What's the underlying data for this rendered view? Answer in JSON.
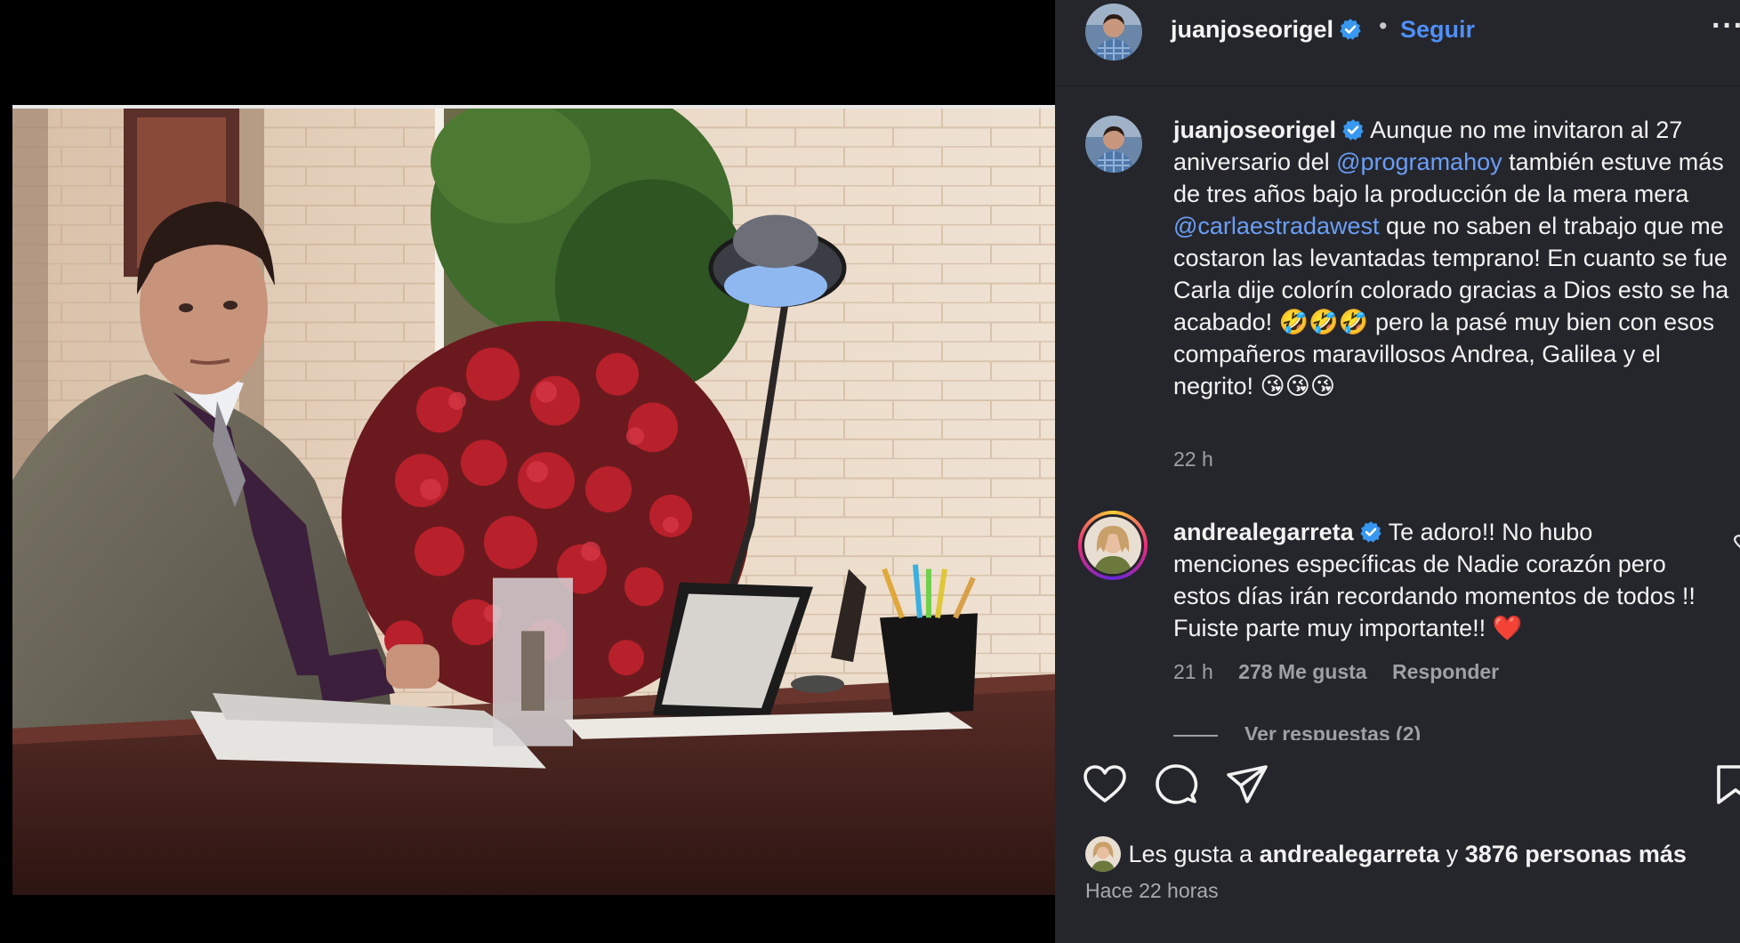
{
  "header": {
    "username": "juanjoseorigel",
    "separator": "•",
    "follow_label": "Seguir",
    "more_label": "···"
  },
  "caption": {
    "username": "juanjoseorigel",
    "text_1": "Aunque no me invitaron al 27 aniversario del",
    "mention_1": "@programahoy",
    "text_2": "también estuve más de tres años bajo la producción de la mera mera",
    "mention_2": "@carlaestradawest",
    "text_3": "que no saben el trabajo que me costaron las levantadas temprano! En cuanto se fue Carla dije colorín colorado gracias a Dios esto se ha acabado! 🤣🤣🤣 pero la pasé muy bien con esos compañeros maravillosos Andrea, Galilea y el negrito! 😘😘😘",
    "time": "22 h"
  },
  "comment": {
    "username": "andrealegarreta",
    "text": "Te adoro!! No hubo menciones específicas de Nadie corazón pero estos días irán recordando momentos de todos !! Fuiste parte muy importante!! ❤️",
    "time": "21 h",
    "likes": "278 Me gusta",
    "reply_label": "Responder",
    "view_replies": "Ver respuestas (2)"
  },
  "likes_line": {
    "prefix": "Les gusta a",
    "user": "andrealegarreta",
    "connector": "y",
    "others": "3876 personas más"
  },
  "post_time": "Hace 22 horas",
  "colors": {
    "panel_bg": "#25262b",
    "link_blue": "#4f8ff7",
    "mention_blue": "#6a9ef8",
    "muted_text": "#9ea0a5",
    "verified_blue": "#3897f0"
  },
  "icons": [
    "verified-badge-icon",
    "more-options-icon",
    "like-heart-icon",
    "comment-bubble-icon",
    "share-send-icon",
    "bookmark-icon",
    "comment-like-heart-icon"
  ]
}
